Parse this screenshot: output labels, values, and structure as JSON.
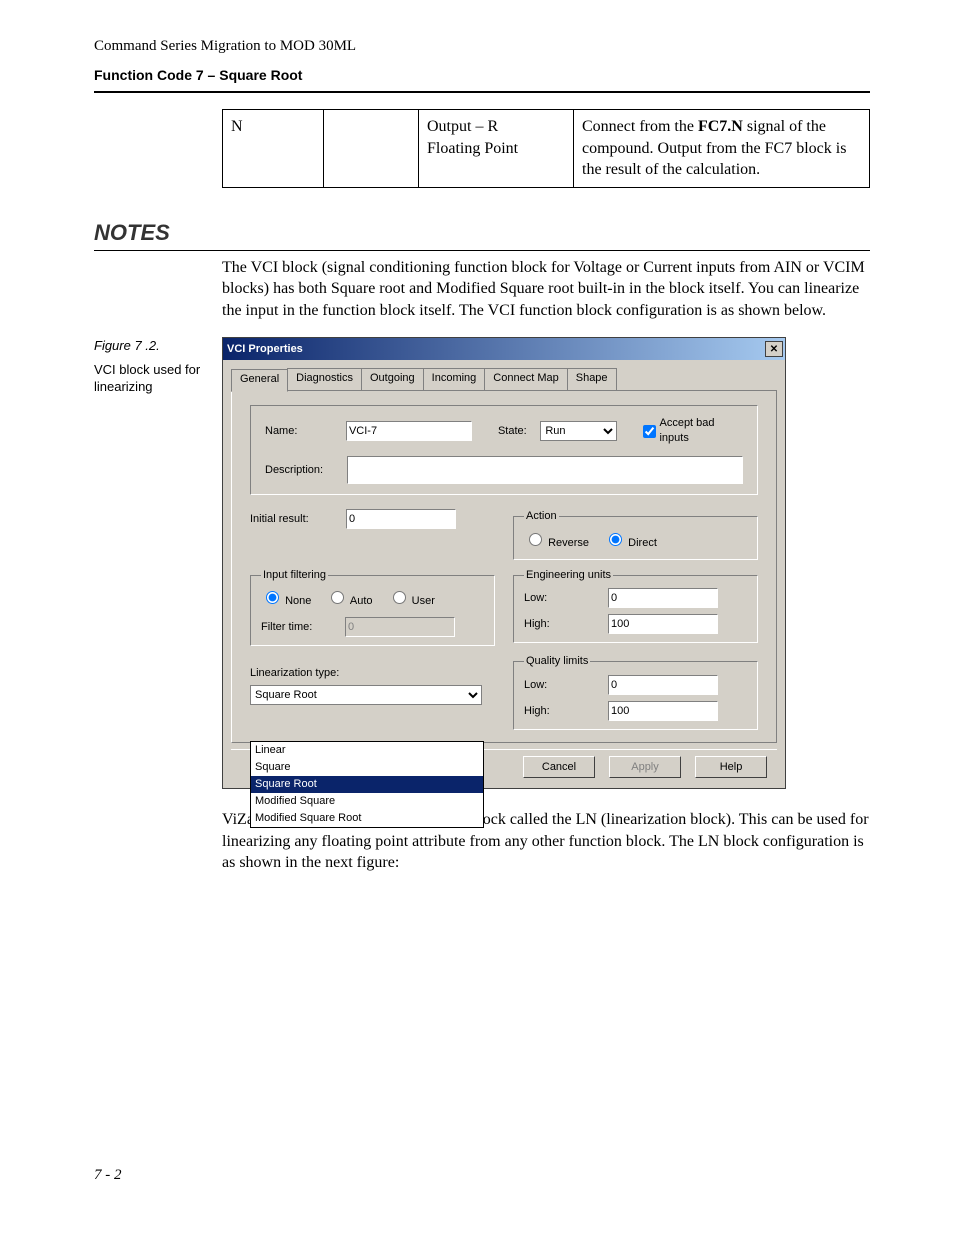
{
  "header": {
    "running": "Command Series Migration to MOD 30ML",
    "section": "Function Code 7 – Square Root"
  },
  "table": {
    "c1": "N",
    "c3a": "Output – R",
    "c3b": "Floating Point",
    "c4_pre": "Connect from the ",
    "c4_bold": "FC7.N",
    "c4_post": " signal of the compound. Output from the FC7 block is the result of the calculation."
  },
  "notes": {
    "heading": "NOTES",
    "para1": "The VCI block (signal conditioning function block for Voltage or Current inputs from AIN or VCIM blocks) has both Square root and Modified Square root built-in in the block itself. You can linearize the input in the function block itself. The VCI function block configuration is as shown below.",
    "para2": "ViZapp also includes another function block called the LN (linearization block). This can be used for linearizing any floating point attribute from any other function block. The LN block configuration is as shown in the next figure:"
  },
  "figure": {
    "label": "Figure 7 .2.",
    "caption": "VCI block used for linearizing"
  },
  "dialog": {
    "title": "VCI Properties",
    "tabs": [
      "General",
      "Diagnostics",
      "Outgoing",
      "Incoming",
      "Connect Map",
      "Shape"
    ],
    "name_label": "Name:",
    "name_val": "VCI-7",
    "state_label": "State:",
    "state_val": "Run",
    "accept_bad": "Accept bad inputs",
    "desc_label": "Description:",
    "desc_val": "",
    "initial_label": "Initial result:",
    "initial_val": "0",
    "action_legend": "Action",
    "action_reverse": "Reverse",
    "action_direct": "Direct",
    "filter_legend": "Input filtering",
    "filter_none": "None",
    "filter_auto": "Auto",
    "filter_user": "User",
    "filter_time_label": "Filter time:",
    "filter_time_val": "0",
    "eng_legend": "Engineering units",
    "eng_low": "0",
    "eng_high": "100",
    "low_label": "Low:",
    "high_label": "High:",
    "ql_legend": "Quality limits",
    "ql_low": "0",
    "ql_high": "100",
    "lin_label": "Linearization type:",
    "lin_val": "Square Root",
    "lin_options": [
      "Linear",
      "Square",
      "Square Root",
      "Modified Square",
      "Modified Square Root"
    ],
    "btn_cancel": "Cancel",
    "btn_apply": "Apply",
    "btn_help": "Help"
  },
  "page_number": "7 - 2"
}
